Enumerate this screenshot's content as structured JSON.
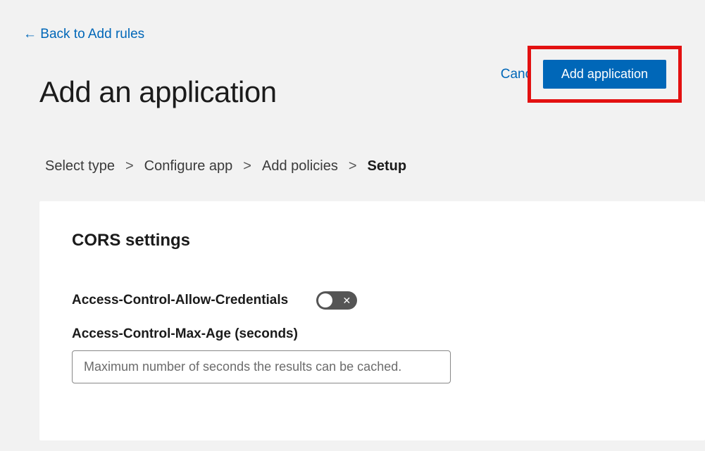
{
  "nav": {
    "back_label": "←  Back to Add rules"
  },
  "header": {
    "title": "Add an application",
    "cancel_label": "Cancel",
    "add_button_label": "Add application"
  },
  "breadcrumb": {
    "items": [
      {
        "label": "Select type",
        "current": false
      },
      {
        "label": "Configure app",
        "current": false
      },
      {
        "label": "Add policies",
        "current": false
      },
      {
        "label": "Setup",
        "current": true
      }
    ],
    "separator": ">"
  },
  "cors": {
    "section_title": "CORS settings",
    "allow_credentials_label": "Access-Control-Allow-Credentials",
    "allow_credentials_value": false,
    "max_age_label": "Access-Control-Max-Age (seconds)",
    "max_age_placeholder": "Maximum number of seconds the results can be cached.",
    "max_age_value": ""
  }
}
